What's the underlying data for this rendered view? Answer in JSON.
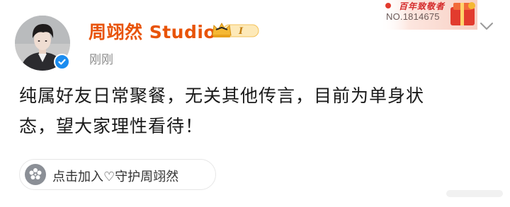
{
  "post": {
    "username": "周翊然 Studio",
    "vip_level": "I",
    "timestamp": "刚刚",
    "content_line1": "纯属好友日常聚餐，无关其他传言，目前为单身状",
    "content_line2": "态，望大家理性看待！",
    "fan_badge": {
      "title": "百年致敬者",
      "number": "NO.1814675"
    },
    "topic": {
      "label": "点击加入♡守护周翊然"
    }
  },
  "colors": {
    "username": "#e8540a",
    "timestamp": "#8a8a8a",
    "verified": "#1a8cf0",
    "badge_gold": "#f5b833",
    "fan_badge_red": "#d42a2a"
  },
  "icons": {
    "verified": "checkmark-icon",
    "vip": "crown-icon",
    "menu": "chevron-down-icon",
    "topic": "flower-icon"
  }
}
